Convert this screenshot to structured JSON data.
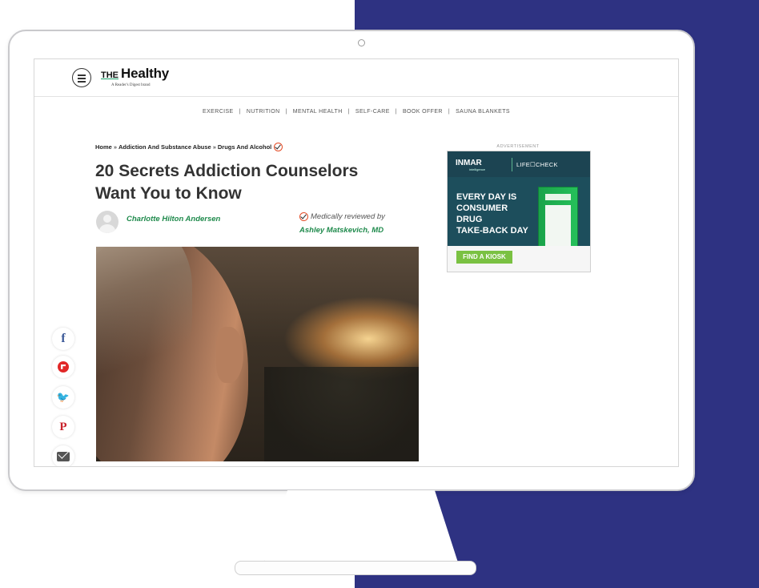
{
  "site": {
    "logo_the": "THE",
    "logo_name": "Healthy",
    "logo_tagline": "A Reader's Digest brand"
  },
  "nav": {
    "items": [
      "EXERCISE",
      "NUTRITION",
      "MENTAL HEALTH",
      "SELF-CARE",
      "BOOK OFFER",
      "SAUNA BLANKETS"
    ],
    "separator": "|"
  },
  "breadcrumb": {
    "items": [
      "Home",
      "Addiction And Substance Abuse",
      "Drugs And Alcohol"
    ],
    "separator": "»"
  },
  "article": {
    "title_line1": "20 Secrets Addiction Counselors",
    "title_line2": "Want You to Know",
    "author": "Charlotte Hilton Andersen",
    "reviewed_label": "Medically reviewed by",
    "reviewer": "Ashley Matskevich, MD"
  },
  "share": {
    "facebook": "f",
    "twitter": "🐦",
    "pinterest": "P"
  },
  "ad": {
    "label": "ADVERTISEMENT",
    "brand1": "INMAR",
    "brand1_sub": "intelligence",
    "brand2": "LIFE☐CHECK",
    "headline_line1": "EVERY DAY IS",
    "headline_line2": "CONSUMER DRUG",
    "headline_line3": "TAKE-BACK DAY",
    "cta": "FIND A KIOSK"
  },
  "colors": {
    "background_panel": "#2e3282",
    "accent_green": "#1f8a4c",
    "badge_orange": "#e44b25",
    "ad_teal": "#1d4e5c",
    "ad_cta": "#7ac142"
  }
}
